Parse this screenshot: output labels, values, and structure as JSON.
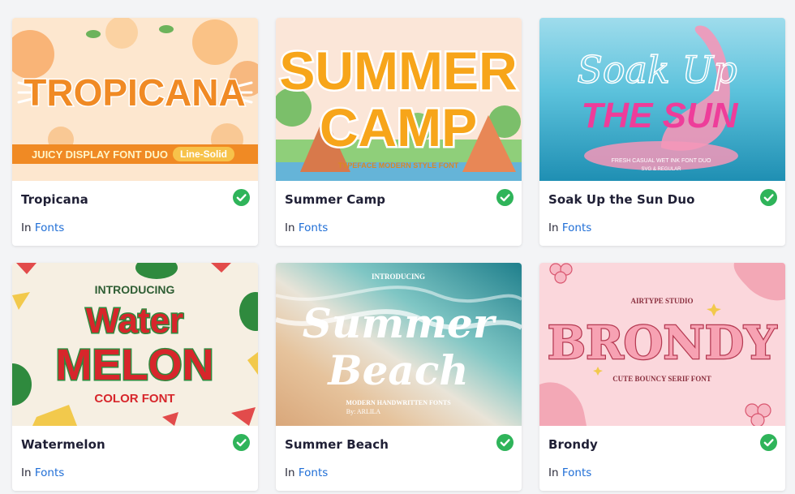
{
  "cards": [
    {
      "title": "Tropicana",
      "category_prefix": "In",
      "category_link": "Fonts",
      "verified_icon": "check-circle-icon",
      "thumbnail": {
        "main": "TROPICANA",
        "tagline": "JUICY DISPLAY FONT DUO",
        "badge": "Line-Solid",
        "accent": "#f08a24",
        "background": "#fde7cf"
      }
    },
    {
      "title": "Summer Camp",
      "category_prefix": "In",
      "category_link": "Fonts",
      "verified_icon": "check-circle-icon",
      "thumbnail": {
        "line1": "SUMMER",
        "line2": "CAMP",
        "tagline": "TYPEFACE MODERN STYLE FONT",
        "accent": "#f7a51a",
        "background": "#fbe6d8"
      }
    },
    {
      "title": "Soak Up the Sun Duo",
      "category_prefix": "In",
      "category_link": "Fonts",
      "verified_icon": "check-circle-icon",
      "thumbnail": {
        "script": "Soak Up",
        "main": "THE SUN",
        "tagline": "FRESH CASUAL WET INK FONT DUO",
        "sub": "SVG & REGULAR",
        "accent": "#ee3d9a",
        "background": "#3db4cf"
      }
    },
    {
      "title": "Watermelon",
      "category_prefix": "In",
      "category_link": "Fonts",
      "verified_icon": "check-circle-icon",
      "thumbnail": {
        "intro": "INTRODUCING",
        "line1": "Water",
        "line2": "MELON",
        "tagline": "COLOR FONT",
        "accent": "#d7262b",
        "background": "#f6efe2"
      }
    },
    {
      "title": "Summer Beach",
      "category_prefix": "In",
      "category_link": "Fonts",
      "verified_icon": "check-circle-icon",
      "thumbnail": {
        "intro": "INTRODUCING",
        "line1": "Summer",
        "line2": "Beach",
        "tagline": "MODERN HANDWRITTEN FONTS",
        "byline": "By: ARLILA",
        "accent": "#2f9eab",
        "background": "#e8c7a1"
      }
    },
    {
      "title": "Brondy",
      "category_prefix": "In",
      "category_link": "Fonts",
      "verified_icon": "check-circle-icon",
      "thumbnail": {
        "studio": "AIRTYPE STUDIO",
        "main": "BRONDY",
        "tagline": "CUTE BOUNCY SERIF FONT",
        "accent": "#e15f7d",
        "background": "#fbd7dc"
      }
    }
  ],
  "colors": {
    "link": "#1f6ed6",
    "check": "#2fb45a",
    "title": "#1f1f35"
  }
}
